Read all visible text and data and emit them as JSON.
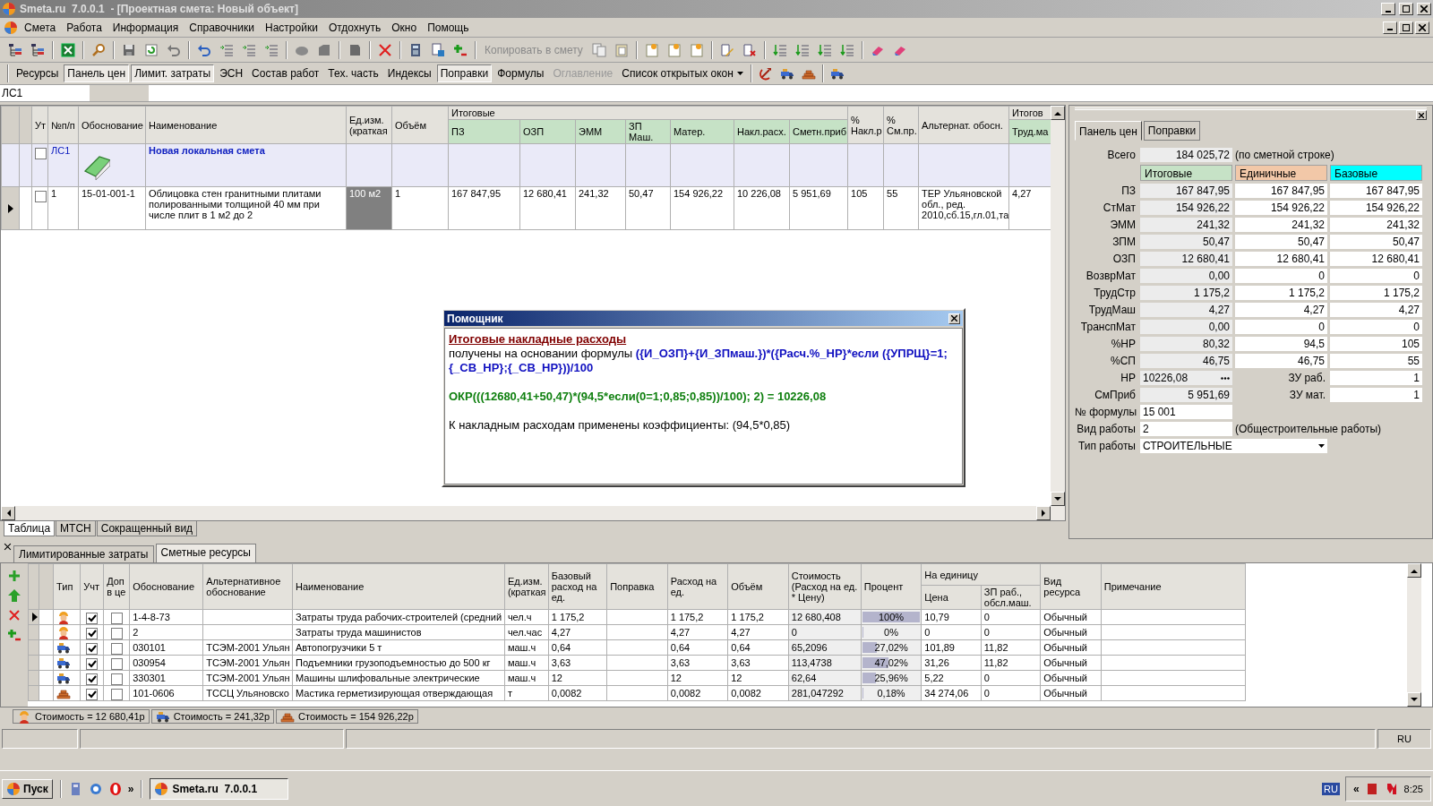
{
  "window": {
    "title": "Smeta.ru  7.0.0.1  - [Проектная смета: Новый объект]"
  },
  "menu": [
    "Смета",
    "Работа",
    "Информация",
    "Справочники",
    "Настройки",
    "Отдохнуть",
    "Окно",
    "Помощь"
  ],
  "toolbar": {
    "copy_label": "Копировать в смету",
    "copy_disabled": true
  },
  "panels_bar": [
    {
      "label": "Ресурсы",
      "selected": false,
      "disabled": false
    },
    {
      "label": "Панель цен",
      "selected": true,
      "disabled": false
    },
    {
      "label": "Лимит. затраты",
      "selected": true,
      "disabled": false
    },
    {
      "label": "ЭСН",
      "selected": false,
      "disabled": false
    },
    {
      "label": "Состав работ",
      "selected": false,
      "disabled": false
    },
    {
      "label": "Тех. часть",
      "selected": false,
      "disabled": false
    },
    {
      "label": "Индексы",
      "selected": false,
      "disabled": false
    },
    {
      "label": "Поправки",
      "selected": true,
      "disabled": false
    },
    {
      "label": "Формулы",
      "selected": false,
      "disabled": false
    },
    {
      "label": "Оглавление",
      "selected": false,
      "disabled": true
    }
  ],
  "open_windows": {
    "label": "Список открытых окон"
  },
  "address": {
    "value": "ЛС1"
  },
  "top_table": {
    "marker_columns": [
      {
        "label": "Ут"
      }
    ],
    "columns": [
      {
        "label": "№п/п"
      },
      {
        "label": "Обоснование"
      },
      {
        "label": "Наименование"
      },
      {
        "label": "Ед.изм.\n(краткая"
      },
      {
        "label": "Объём"
      },
      {
        "label": "Итоговые",
        "children": [
          {
            "label": "ПЗ"
          },
          {
            "label": "ОЗП"
          },
          {
            "label": "ЭММ"
          },
          {
            "label": "ЗП Маш."
          },
          {
            "label": "Матер."
          },
          {
            "label": "Накл.расх."
          },
          {
            "label": "Сметн.приб"
          }
        ]
      },
      {
        "label": "%\nНакл.р"
      },
      {
        "label": "%\nСм.пр."
      },
      {
        "label": "Альтернат. обосн."
      },
      {
        "label": "Итогов",
        "children": [
          {
            "label": "Труд.ма"
          }
        ]
      }
    ],
    "rows": [
      {
        "kind": "section",
        "current": false,
        "checked": false,
        "number": "ЛС1",
        "name": "Новая локальная смета"
      },
      {
        "kind": "item",
        "current": true,
        "checked": false,
        "cells": [
          {
            "text": "1",
            "selected": false
          },
          {
            "text": "15-01-001-1",
            "selected": false
          },
          {
            "text": "Облицовка стен гранитными плитами полированными толщиной 40 мм при числе плит в 1 м2 до 2",
            "selected": false
          },
          {
            "text": "100 м2",
            "selected": true
          },
          {
            "text": "1",
            "selected": false
          },
          {
            "text": "167 847,95",
            "selected": false
          },
          {
            "text": "12 680,41",
            "selected": false
          },
          {
            "text": "241,32",
            "selected": false
          },
          {
            "text": "50,47",
            "selected": false
          },
          {
            "text": "154 926,22",
            "selected": false
          },
          {
            "text": "10 226,08",
            "selected": false
          },
          {
            "text": "5 951,69",
            "selected": false
          },
          {
            "text": "105",
            "selected": false
          },
          {
            "text": "55",
            "selected": false
          },
          {
            "text": "ТЕР Ульяновской обл., ред. 2010,сб.15,гл.01,та",
            "selected": false
          },
          {
            "text": "4,27",
            "selected": false
          }
        ]
      }
    ]
  },
  "view_tabs": [
    {
      "label": "Таблица",
      "selected": true
    },
    {
      "label": "МТСН",
      "selected": false
    },
    {
      "label": "Сокращенный вид",
      "selected": false
    }
  ],
  "helper_dialog": {
    "title": "Помощник",
    "heading": "Итоговые накладные расходы",
    "intro": "получены на основании формулы",
    "formula": "({И_ОЗП}+{И_ЗПмаш.})*({Расч.%_НР}*если ({УПРЩ}=1;{_СВ_НР};{_СВ_НР}))/100",
    "calculation": "ОКР(((12680,41+50,47)*(94,5*если(0=1;0,85;0,85))/100); 2) = 10226,08",
    "note": "К накладным расходам применены коэффициенты: (94,5*0,85)"
  },
  "price_panel": {
    "tabs": [
      {
        "label": "Панель цен",
        "selected": true
      },
      {
        "label": "Поправки",
        "selected": false
      }
    ],
    "total": {
      "label": "Всего",
      "value": "184 025,72",
      "note": "(по сметной строке)"
    },
    "headers": [
      {
        "label": "Итоговые",
        "color": "#c6e2c6"
      },
      {
        "label": "Единичные",
        "color": "#f2c8a8"
      },
      {
        "label": "Базовые",
        "color": "#00ffff"
      }
    ],
    "rows": [
      {
        "label": "ПЗ",
        "values": [
          "167 847,95",
          "167 847,95",
          "167 847,95"
        ]
      },
      {
        "label": "СтМат",
        "values": [
          "154 926,22",
          "154 926,22",
          "154 926,22"
        ]
      },
      {
        "label": "ЭММ",
        "values": [
          "241,32",
          "241,32",
          "241,32"
        ]
      },
      {
        "label": "ЗПМ",
        "values": [
          "50,47",
          "50,47",
          "50,47"
        ]
      },
      {
        "label": "ОЗП",
        "values": [
          "12 680,41",
          "12 680,41",
          "12 680,41"
        ]
      },
      {
        "label": "ВозврМат",
        "values": [
          "0,00",
          "0",
          "0"
        ]
      },
      {
        "label": "ТрудСтр",
        "values": [
          "1 175,2",
          "1 175,2",
          "1 175,2"
        ]
      },
      {
        "label": "ТрудМаш",
        "values": [
          "4,27",
          "4,27",
          "4,27"
        ]
      },
      {
        "label": "ТранспМат",
        "values": [
          "0,00",
          "0",
          "0"
        ]
      },
      {
        "label": "%НР",
        "values": [
          "80,32",
          "94,5",
          "105"
        ]
      },
      {
        "label": "%СП",
        "values": [
          "46,75",
          "46,75",
          "55"
        ]
      }
    ],
    "overhead": {
      "label": "НР",
      "value": "10226,08",
      "extra_label": "ЗУ раб.",
      "extra_value": "1"
    },
    "profit": {
      "label": "СмПриб",
      "value": "5 951,69",
      "extra_label": "ЗУ мат.",
      "extra_value": "1"
    },
    "formula": {
      "label": "№ формулы",
      "value": "15 001"
    },
    "work_kind": {
      "label": "Вид работы",
      "value": "2",
      "note": "(Общестроительные работы)"
    },
    "work_type": {
      "label": "Тип работы",
      "value": "СТРОИТЕЛЬНЫЕ"
    }
  },
  "lower_tabs": [
    {
      "label": "Лимитированные затраты",
      "selected": false
    },
    {
      "label": "Сметные ресурсы",
      "selected": true
    }
  ],
  "resources_table": {
    "marker_columns": [
      {
        "label": "Тип"
      },
      {
        "label": "Учт"
      },
      {
        "label": "Доп\nв це"
      }
    ],
    "columns": [
      {
        "label": "Обоснование"
      },
      {
        "label": "Альтернативное обоснование"
      },
      {
        "label": "Наименование"
      },
      {
        "label": "Ед.изм.\n(краткая"
      },
      {
        "label": "Базовый расход на ед."
      },
      {
        "label": "Поправка"
      },
      {
        "label": "Расход на ед."
      },
      {
        "label": "Объём"
      },
      {
        "label": "Стоимость (Расход на ед. * Цену)"
      },
      {
        "label": "Процент"
      },
      {
        "label": "Цена",
        "grouped": true
      },
      {
        "label": "ЗП раб., обсл.маш.",
        "grouped": true
      },
      {
        "label": "Вид ресурса"
      },
      {
        "label": "Примечание"
      }
    ],
    "group_header": {
      "label": "На единицу"
    },
    "rows": [
      {
        "kind": "worker",
        "current": true,
        "counted": true,
        "extra": false,
        "level": 1,
        "cells": [
          "1-4-8-73",
          null,
          "Затраты труда рабочих-строителей (средний",
          "чел.ч",
          "1 175,2",
          null,
          "1 175,2",
          "1 175,2",
          "12 680,408",
          "100%",
          "10,79",
          "0",
          "Обычный",
          null
        ]
      },
      {
        "kind": "worker",
        "current": false,
        "counted": true,
        "extra": false,
        "level": 0,
        "cells": [
          "2",
          null,
          "Затраты труда машинистов",
          "чел.час",
          "4,27",
          null,
          "4,27",
          "4,27",
          "0",
          "0%",
          "0",
          "0",
          "Обычный",
          null
        ]
      },
      {
        "kind": "machine",
        "current": false,
        "counted": true,
        "extra": false,
        "level": 0.2702,
        "cells": [
          "030101",
          "ТСЭМ-2001 Ульян",
          "Автопогрузчики 5 т",
          "маш.ч",
          "0,64",
          null,
          "0,64",
          "0,64",
          "65,2096",
          "27,02%",
          "101,89",
          "11,82",
          "Обычный",
          null
        ]
      },
      {
        "kind": "machine",
        "current": false,
        "counted": true,
        "extra": false,
        "level": 0.4702,
        "cells": [
          "030954",
          "ТСЭМ-2001 Ульян",
          "Подъемники грузоподъемностью до 500 кг",
          "маш.ч",
          "3,63",
          null,
          "3,63",
          "3,63",
          "113,4738",
          "47,02%",
          "31,26",
          "11,82",
          "Обычный",
          null
        ]
      },
      {
        "kind": "machine",
        "current": false,
        "counted": true,
        "extra": false,
        "level": 0.2596,
        "cells": [
          "330301",
          "ТСЭМ-2001 Ульян",
          "Машины шлифовальные электрические",
          "маш.ч",
          "12",
          null,
          "12",
          "12",
          "62,64",
          "25,96%",
          "5,22",
          "0",
          "Обычный",
          null
        ]
      },
      {
        "kind": "material",
        "current": false,
        "counted": true,
        "extra": false,
        "level": 0.0018,
        "cells": [
          "101-0606",
          "ТССЦ Ульяновско",
          "Мастика герметизирующая отверждающая",
          "т",
          "0,0082",
          null,
          "0,0082",
          "0,0082",
          "281,047292",
          "0,18%",
          "34 274,06",
          "0",
          "Обычный",
          null
        ]
      }
    ]
  },
  "cost_summary": [
    {
      "kind": "worker",
      "text": "Стоимость = 12 680,41р"
    },
    {
      "kind": "machine",
      "text": "Стоимость = 241,32р"
    },
    {
      "kind": "material",
      "text": "Стоимость = 154 926,22р"
    }
  ],
  "status_bar": {
    "language": "RU"
  },
  "taskbar": {
    "start": "Пуск",
    "more": "»",
    "tasks": [
      {
        "label": "Smeta.ru  7.0.0.1",
        "selected": true
      }
    ],
    "language": "RU",
    "tray_toggle": "«",
    "time": "8:25"
  }
}
